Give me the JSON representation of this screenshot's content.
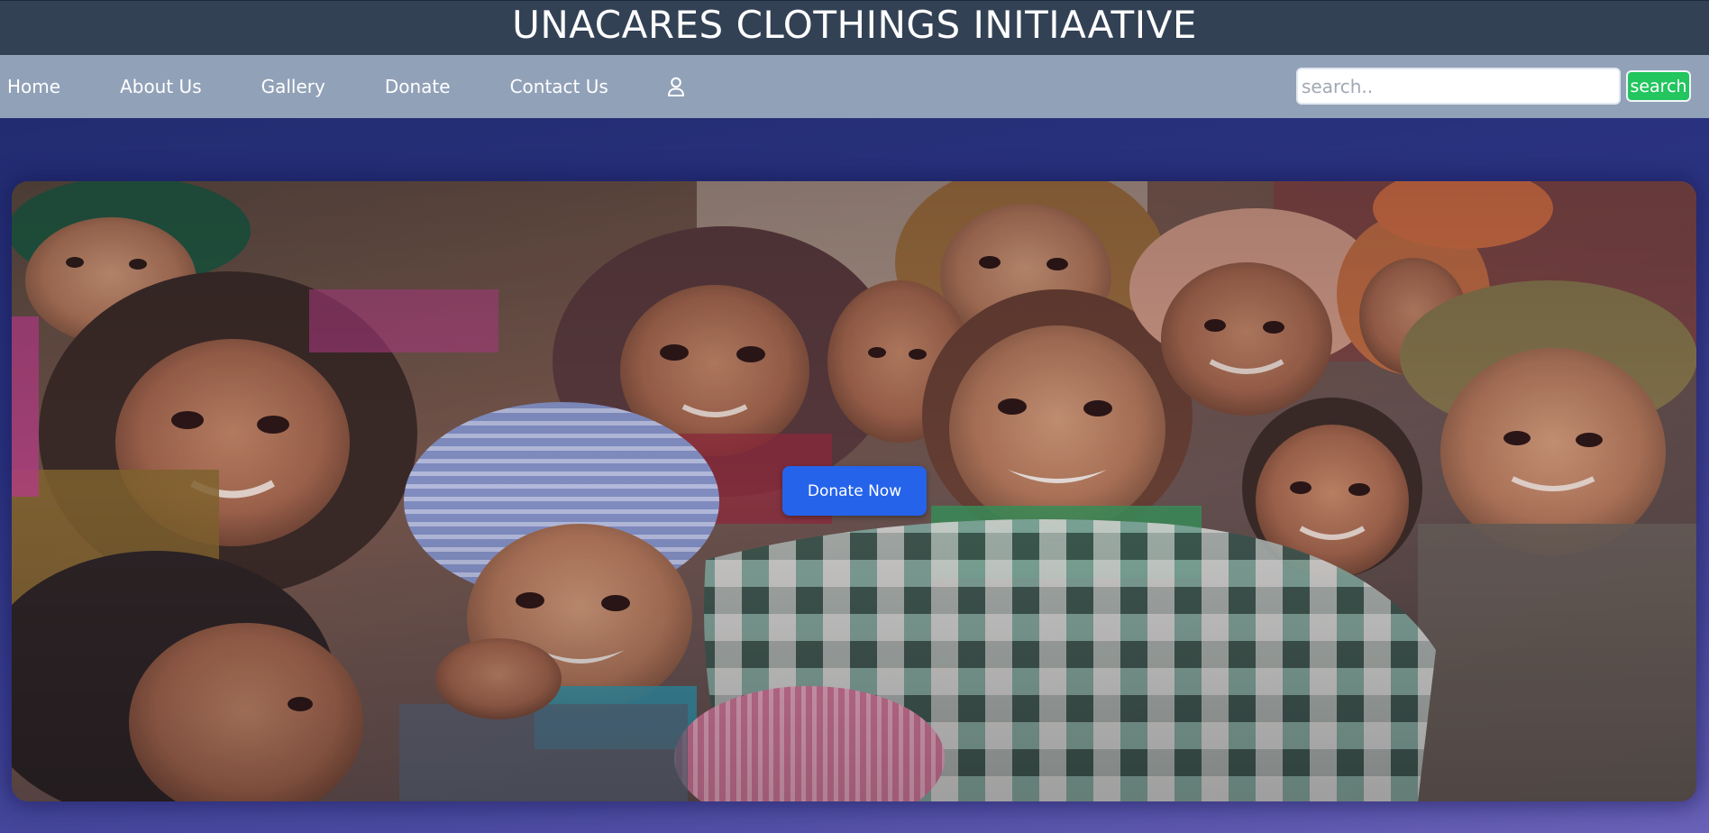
{
  "header": {
    "site_title": "UNACARES CLOTHINGS INITIAATIVE"
  },
  "nav": {
    "items": [
      {
        "label": "Home"
      },
      {
        "label": "About Us"
      },
      {
        "label": "Gallery"
      },
      {
        "label": "Donate"
      },
      {
        "label": "Contact Us"
      }
    ],
    "user_icon": "user-icon"
  },
  "search": {
    "placeholder": "search..",
    "value": "",
    "button_label": "search"
  },
  "hero": {
    "image_description_icon": "hero-photo-children",
    "cta_label": "Donate Now"
  },
  "colors": {
    "title_bar_bg": "#334155",
    "nav_bg": "#91a1b8",
    "search_button": "#22c55e",
    "cta_button": "#2563eb",
    "page_bg": "#2a3380"
  }
}
